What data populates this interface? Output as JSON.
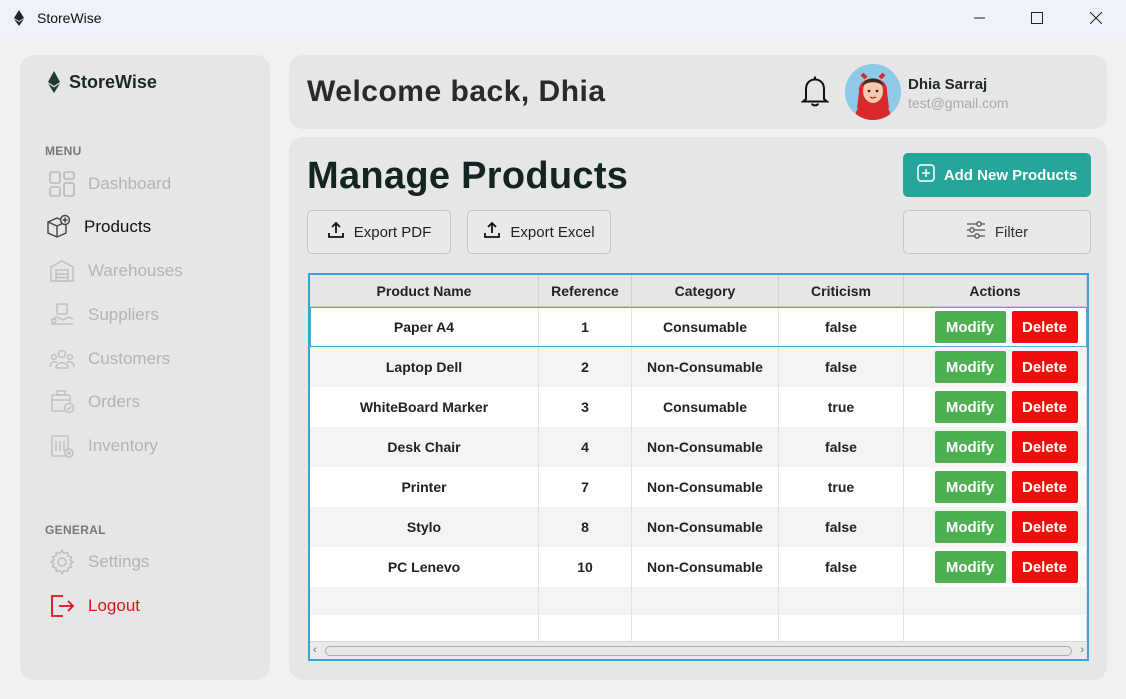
{
  "window": {
    "title": "StoreWise"
  },
  "sidebar": {
    "brand": "StoreWise",
    "menu_label": "MENU",
    "general_label": "GENERAL",
    "items": [
      {
        "label": "Dashboard",
        "icon": "dashboard-icon"
      },
      {
        "label": "Products",
        "icon": "products-icon"
      },
      {
        "label": "Warehouses",
        "icon": "warehouse-icon"
      },
      {
        "label": "Suppliers",
        "icon": "suppliers-icon"
      },
      {
        "label": "Customers",
        "icon": "customers-icon"
      },
      {
        "label": "Orders",
        "icon": "orders-icon"
      },
      {
        "label": "Inventory",
        "icon": "inventory-icon"
      }
    ],
    "general_items": [
      {
        "label": "Settings",
        "icon": "gear-icon"
      },
      {
        "label": "Logout",
        "icon": "logout-icon"
      }
    ],
    "active": "Products"
  },
  "header": {
    "welcome": "Welcome back, Dhia",
    "user_name": "Dhia Sarraj",
    "user_email": "test@gmail.com"
  },
  "main": {
    "title": "Manage Products",
    "add_button": "Add New Products",
    "export_pdf": "Export PDF",
    "export_excel": "Export Excel",
    "filter": "Filter",
    "table": {
      "columns": [
        "Product Name",
        "Reference",
        "Category",
        "Criticism",
        "Actions"
      ],
      "modify_label": "Modify",
      "delete_label": "Delete",
      "rows": [
        {
          "name": "Paper A4",
          "reference": "1",
          "category": "Consumable",
          "criticism": "false"
        },
        {
          "name": "Laptop Dell",
          "reference": "2",
          "category": "Non-Consumable",
          "criticism": "false"
        },
        {
          "name": "WhiteBoard Marker",
          "reference": "3",
          "category": "Consumable",
          "criticism": "true"
        },
        {
          "name": "Desk Chair",
          "reference": "4",
          "category": "Non-Consumable",
          "criticism": "false"
        },
        {
          "name": "Printer",
          "reference": "7",
          "category": "Non-Consumable",
          "criticism": "true"
        },
        {
          "name": "Stylo",
          "reference": "8",
          "category": "Non-Consumable",
          "criticism": "false"
        },
        {
          "name": "PC Lenevo",
          "reference": "10",
          "category": "Non-Consumable",
          "criticism": "false"
        }
      ]
    }
  },
  "colors": {
    "accent": "#26a69a",
    "modify": "#4caf50",
    "delete": "#f40b0b",
    "logout": "#e0101a",
    "table_border": "#35a6d8"
  }
}
